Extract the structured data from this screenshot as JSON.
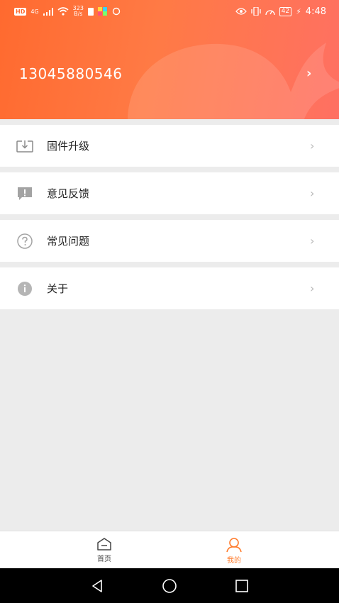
{
  "status_bar": {
    "hd": "HD",
    "network": "4G",
    "speed_value": "323",
    "speed_unit": "B/s",
    "battery": "42",
    "time": "4:48"
  },
  "profile": {
    "phone": "13045880546"
  },
  "menu": {
    "items": [
      {
        "label": "固件升级",
        "icon": "download-icon"
      },
      {
        "label": "意见反馈",
        "icon": "feedback-icon"
      },
      {
        "label": "常见问题",
        "icon": "help-icon"
      },
      {
        "label": "关于",
        "icon": "info-icon"
      }
    ]
  },
  "tabbar": {
    "home": "首页",
    "mine": "我的"
  },
  "colors": {
    "accent": "#ff7a2a",
    "header_start": "#ff6a2f",
    "header_end": "#ff7062"
  }
}
